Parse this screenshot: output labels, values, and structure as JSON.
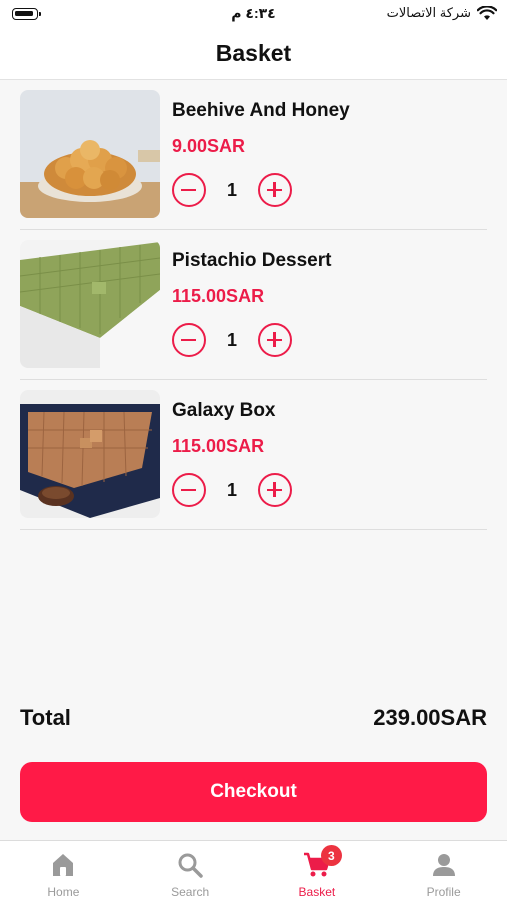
{
  "status_bar": {
    "time": "٤:٣٤ م",
    "carrier": "شركة الاتصالات"
  },
  "header": {
    "title": "Basket"
  },
  "items": [
    {
      "name": "Beehive And Honey",
      "price": "9.00SAR",
      "quantity": "1",
      "image": "honey-bread-photo"
    },
    {
      "name": "Pistachio Dessert",
      "price": "115.00SAR",
      "quantity": "1",
      "image": "pistachio-dessert-photo"
    },
    {
      "name": "Galaxy Box",
      "price": "115.00SAR",
      "quantity": "1",
      "image": "chocolate-box-photo"
    }
  ],
  "total": {
    "label": "Total",
    "value": "239.00SAR"
  },
  "checkout": {
    "label": "Checkout"
  },
  "tabbar": {
    "tabs": [
      {
        "label": "Home",
        "icon": "home-icon"
      },
      {
        "label": "Search",
        "icon": "search-icon"
      },
      {
        "label": "Basket",
        "icon": "cart-icon",
        "badge": "3",
        "active": true
      },
      {
        "label": "Profile",
        "icon": "person-icon"
      }
    ]
  },
  "colors": {
    "accent": "#ec1c49",
    "checkout_bg": "#ff1a47",
    "badge": "#ec3340",
    "inactive_tab": "#9a9a9a"
  }
}
